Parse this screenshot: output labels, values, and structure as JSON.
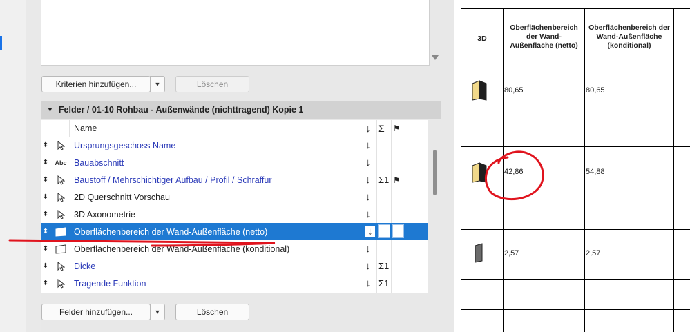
{
  "buttons": {
    "add_criteria": "Kriterien hinzufügen...",
    "delete_criteria": "Löschen",
    "add_fields": "Felder hinzufügen...",
    "delete_fields": "Löschen"
  },
  "section": {
    "title": "Felder / 01-10 Rohbau - Außenwände (nichttragend) Kopie 1"
  },
  "list": {
    "header_name": "Name",
    "header_sort_icon": "↓",
    "header_sum_icon": "Σ",
    "header_flag_icon": "flag-icon",
    "rows": [
      {
        "label": "Ursprungsgeschoss Name",
        "blue": true,
        "icon": "pointer",
        "sort": "↓",
        "sum": "",
        "flag": ""
      },
      {
        "label": "Bauabschnitt",
        "blue": true,
        "icon": "Abc",
        "sort": "↓",
        "sum": "",
        "flag": ""
      },
      {
        "label": "Baustoff / Mehrschichtiger Aufbau / Profil / Schraffur",
        "blue": true,
        "icon": "pointer",
        "sort": "↓",
        "sum": "Σ1",
        "flag": "⚑"
      },
      {
        "label": "2D Querschnitt Vorschau",
        "blue": false,
        "icon": "pointer",
        "sort": "↓",
        "sum": "",
        "flag": ""
      },
      {
        "label": "3D Axonometrie",
        "blue": false,
        "icon": "pointer",
        "sort": "↓",
        "sum": "",
        "flag": ""
      },
      {
        "label": "Oberflächenbereich der Wand-Außenfläche (netto)",
        "blue": false,
        "icon": "surface",
        "sort": "↓",
        "sum": "",
        "flag": "",
        "selected": true
      },
      {
        "label": "Oberflächenbereich der Wand-Außenfläche (konditional)",
        "blue": false,
        "icon": "surface",
        "sort": "↓",
        "sum": "",
        "flag": ""
      },
      {
        "label": "Dicke",
        "blue": true,
        "icon": "pointer",
        "sort": "↓",
        "sum": "Σ1",
        "flag": ""
      },
      {
        "label": "Tragende Funktion",
        "blue": true,
        "icon": "pointer",
        "sort": "↓",
        "sum": "Σ1",
        "flag": ""
      }
    ]
  },
  "schedule": {
    "headers": {
      "col_3d": "3D",
      "col_netto": "Oberflächenbereich der Wand-Außenfläche (netto)",
      "col_kond": "Oberflächenbereich der Wand-Außenfläche (konditional)"
    },
    "rows": [
      {
        "netto": "80,65",
        "kond": "80,65"
      },
      {
        "netto": "42,86",
        "kond": "54,88"
      },
      {
        "netto": "2,57",
        "kond": "2,57"
      }
    ]
  },
  "colors": {
    "selection": "#1e79d2",
    "link_text": "#2b3ab8",
    "annotation": "#e0141e"
  }
}
